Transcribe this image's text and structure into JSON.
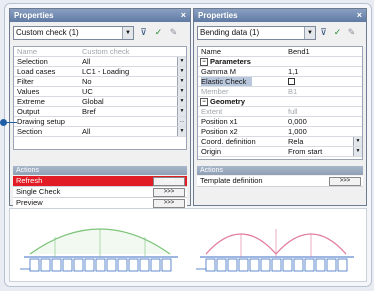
{
  "left_panel": {
    "title": "Properties",
    "close_glyph": "×",
    "combo_value": "Custom check (1)",
    "rows": [
      {
        "key": "Name",
        "value": "Custom check",
        "dim": true
      },
      {
        "key": "Selection",
        "value": "All",
        "dropdown": true
      },
      {
        "key": "Load cases",
        "value": "LC1 - Loading",
        "dropdown": true
      },
      {
        "key": "Filter",
        "value": "No",
        "dropdown": true
      },
      {
        "key": "Values",
        "value": "UC",
        "dropdown": true
      },
      {
        "key": "Extreme",
        "value": "Global",
        "dropdown": true
      },
      {
        "key": "Output",
        "value": "Bref",
        "dropdown": true
      },
      {
        "key": "Drawing setup",
        "value": "",
        "button": "..."
      },
      {
        "key": "Section",
        "value": "All",
        "dropdown": true
      }
    ],
    "actions_header": "Actions",
    "actions": [
      {
        "label": "Refresh",
        "button": ">>>",
        "highlight": true
      },
      {
        "label": "Single Check",
        "button": ">>>"
      },
      {
        "label": "Preview",
        "button": ">>>"
      }
    ]
  },
  "right_panel": {
    "title": "Properties",
    "close_glyph": "×",
    "combo_value": "Bending data (1)",
    "rows": [
      {
        "key": "Name",
        "value": "Bend1"
      },
      {
        "key": "Parameters",
        "group": true
      },
      {
        "key": "Gamma M",
        "value": "1,1"
      },
      {
        "key": "Elastic Check",
        "value": "",
        "checkbox": true,
        "selected": true
      },
      {
        "key": "Member",
        "value": "B1",
        "dim": true
      },
      {
        "key": "Geometry",
        "group": true
      },
      {
        "key": "Extent",
        "value": "full",
        "dim": true
      },
      {
        "key": "Position x1",
        "value": "0,000"
      },
      {
        "key": "Position x2",
        "value": "1,000"
      },
      {
        "key": "Coord. definition",
        "value": "Rela",
        "dropdown": true
      },
      {
        "key": "Origin",
        "value": "From start",
        "dropdown": true
      }
    ],
    "actions_header": "Actions",
    "actions": [
      {
        "label": "Template definition",
        "button": ">>>"
      }
    ]
  },
  "colors": {
    "accent_red": "#e21c25",
    "title_bar": "#6f87ae",
    "arch_green": "#7cc47a",
    "arch_red": "#e07a9a",
    "beam_blue": "#3c6ec4"
  },
  "icons": {
    "toolbar": [
      "filter-icon",
      "filter-check-icon",
      "edit-icon"
    ]
  }
}
